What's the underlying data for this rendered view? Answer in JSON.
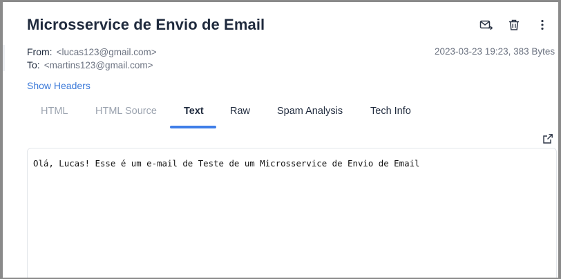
{
  "email": {
    "subject": "Microsservice de Envio de Email",
    "from_label": "From:",
    "from_address": "<lucas123@gmail.com>",
    "to_label": "To:",
    "to_address": "<martins123@gmail.com>",
    "date_size": "2023-03-23 19:23, 383 Bytes",
    "show_headers": "Show Headers",
    "body_text": "Olá, Lucas! Esse é um e-mail de Teste de um Microsservice de Envio de Email"
  },
  "toolbar": {
    "icons": [
      "forward-mail-icon",
      "trash-icon",
      "more-vertical-icon"
    ]
  },
  "tabs": [
    {
      "label": "HTML",
      "state": "disabled"
    },
    {
      "label": "HTML Source",
      "state": "disabled"
    },
    {
      "label": "Text",
      "state": "active"
    },
    {
      "label": "Raw",
      "state": "normal"
    },
    {
      "label": "Spam Analysis",
      "state": "normal"
    },
    {
      "label": "Tech Info",
      "state": "normal"
    }
  ],
  "colors": {
    "accent": "#3f7ee8",
    "link": "#3c7ad9",
    "title": "#1f2a3d",
    "muted": "#9ba3af"
  }
}
